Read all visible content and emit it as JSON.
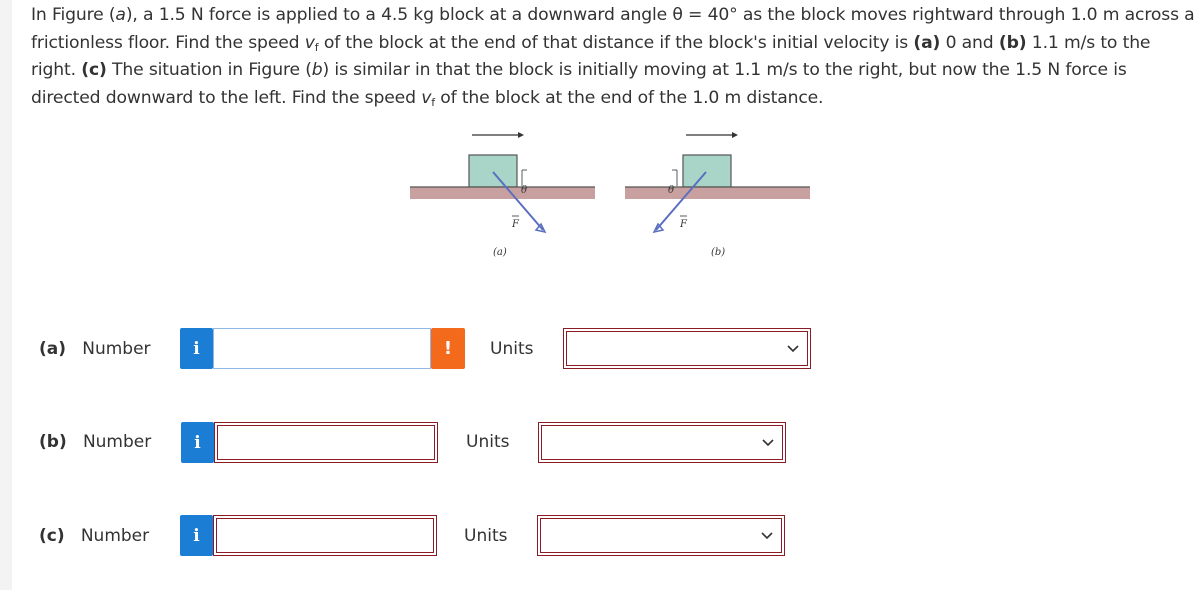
{
  "problem": {
    "s1": "In Figure (",
    "fig_a": "a",
    "s2": "), a 1.5 N force is applied to a 4.5 kg block at a downward angle θ = 40° as the block moves rightward through 1.0 m across a frictionless floor. Find the speed ",
    "vf_v": "v",
    "vf_sub": "f",
    "s3": " of the block at the end of that distance if the block's initial velocity is ",
    "part_a": "(a)",
    "s4": " 0 and ",
    "part_b": "(b)",
    "s5": " 1.1 m/s to the right. ",
    "part_c": "(c)",
    "s6": " The situation in Figure (",
    "fig_b": "b",
    "s7": ") is similar in that the block is initially moving at 1.1 m/s to the right, but now the 1.5 N force is directed downward to the left. Find the speed ",
    "vf2_v": "v",
    "vf2_sub": "f",
    "s8": " of the block at the end of the 1.0 m distance."
  },
  "figure": {
    "caption_a": "(a)",
    "caption_b": "(b)",
    "theta": "θ",
    "force": "F",
    "block_color": "#a8d5c8",
    "floor_color": "#c9a0a0",
    "arrow_color": "#5a6fc0"
  },
  "answers": [
    {
      "label": "(a)",
      "number_label": "Number",
      "info_icon": "i",
      "value": "",
      "warning_icon": "!",
      "units_label": "Units",
      "units_value": ""
    },
    {
      "label": "(b)",
      "number_label": "Number",
      "info_icon": "i",
      "value": "",
      "units_label": "Units",
      "units_value": ""
    },
    {
      "label": "(c)",
      "number_label": "Number",
      "info_icon": "i",
      "value": "",
      "units_label": "Units",
      "units_value": ""
    }
  ],
  "colors": {
    "info": "#1b7ed4",
    "warning": "#f36a1d",
    "field_border": "#8a1c25",
    "active_border": "#8fb8e6"
  }
}
